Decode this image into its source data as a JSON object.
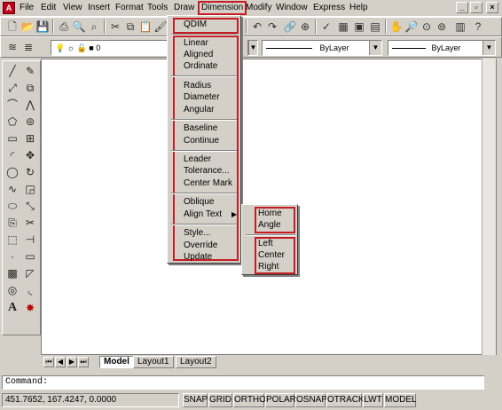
{
  "menubar": {
    "app_icon": "autocad-icon",
    "items": [
      "File",
      "Edit",
      "View",
      "Insert",
      "Format",
      "Tools",
      "Draw",
      "Dimension",
      "Modify",
      "Window",
      "Express",
      "Help"
    ],
    "active": "Dimension"
  },
  "toolbar2": {
    "layer_value": "0",
    "linetype_value": "ByLayer",
    "lineweight_value": "ByLayer"
  },
  "dimension_menu": {
    "qdim": "QDIM",
    "group1": [
      "Linear",
      "Aligned",
      "Ordinate"
    ],
    "group2": [
      "Radius",
      "Diameter",
      "Angular"
    ],
    "group3": [
      "Baseline",
      "Continue"
    ],
    "group4": [
      "Leader",
      "Tolerance...",
      "Center Mark"
    ],
    "group5": [
      "Oblique",
      "Align Text"
    ],
    "group6": [
      "Style...",
      "Override",
      "Update"
    ]
  },
  "align_text_submenu": {
    "group1": [
      "Home",
      "Angle"
    ],
    "group2": [
      "Left",
      "Center",
      "Right"
    ]
  },
  "tabs": [
    "Model",
    "Layout1",
    "Layout2"
  ],
  "command": {
    "prompt": "Command:"
  },
  "status": {
    "coords": "451.7652, 167.4247, 0.0000",
    "buttons": [
      "SNAP",
      "GRID",
      "ORTHO",
      "POLAR",
      "OSNAP",
      "OTRACK",
      "LWT",
      "MODEL"
    ]
  },
  "colors": {
    "highlight": "#c41e24",
    "chrome": "#d4d0c8"
  }
}
